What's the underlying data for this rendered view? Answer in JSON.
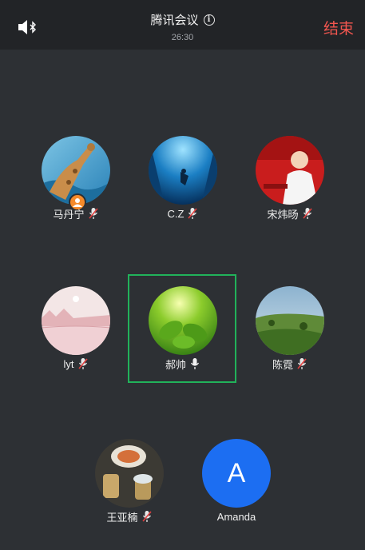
{
  "header": {
    "title": "腾讯会议",
    "timer": "26:30",
    "end_label": "结束",
    "speaker_icon": "speaker-bluetooth-icon",
    "info_icon": "info-icon"
  },
  "colors": {
    "background": "#2d3034",
    "header_bg": "#222427",
    "end_red": "#f2564f",
    "active_speaker_border": "#21b25a",
    "host_badge": "#f58a2a",
    "muted_mic": "#e04040",
    "letter_avatar": "#1c6ef2"
  },
  "participants": [
    {
      "name": "马丹宁",
      "mic": "muted",
      "is_host": true
    },
    {
      "name": "C.Z",
      "mic": "muted"
    },
    {
      "name": "宋炜旸",
      "mic": "muted"
    },
    {
      "name": "lyt",
      "mic": "muted"
    },
    {
      "name": "郝帅",
      "mic": "on",
      "is_speaking": true
    },
    {
      "name": "陈霓",
      "mic": "muted"
    },
    {
      "name": "王亚楠",
      "mic": "muted"
    },
    {
      "name": "Amanda",
      "avatar_letter": "A"
    }
  ]
}
